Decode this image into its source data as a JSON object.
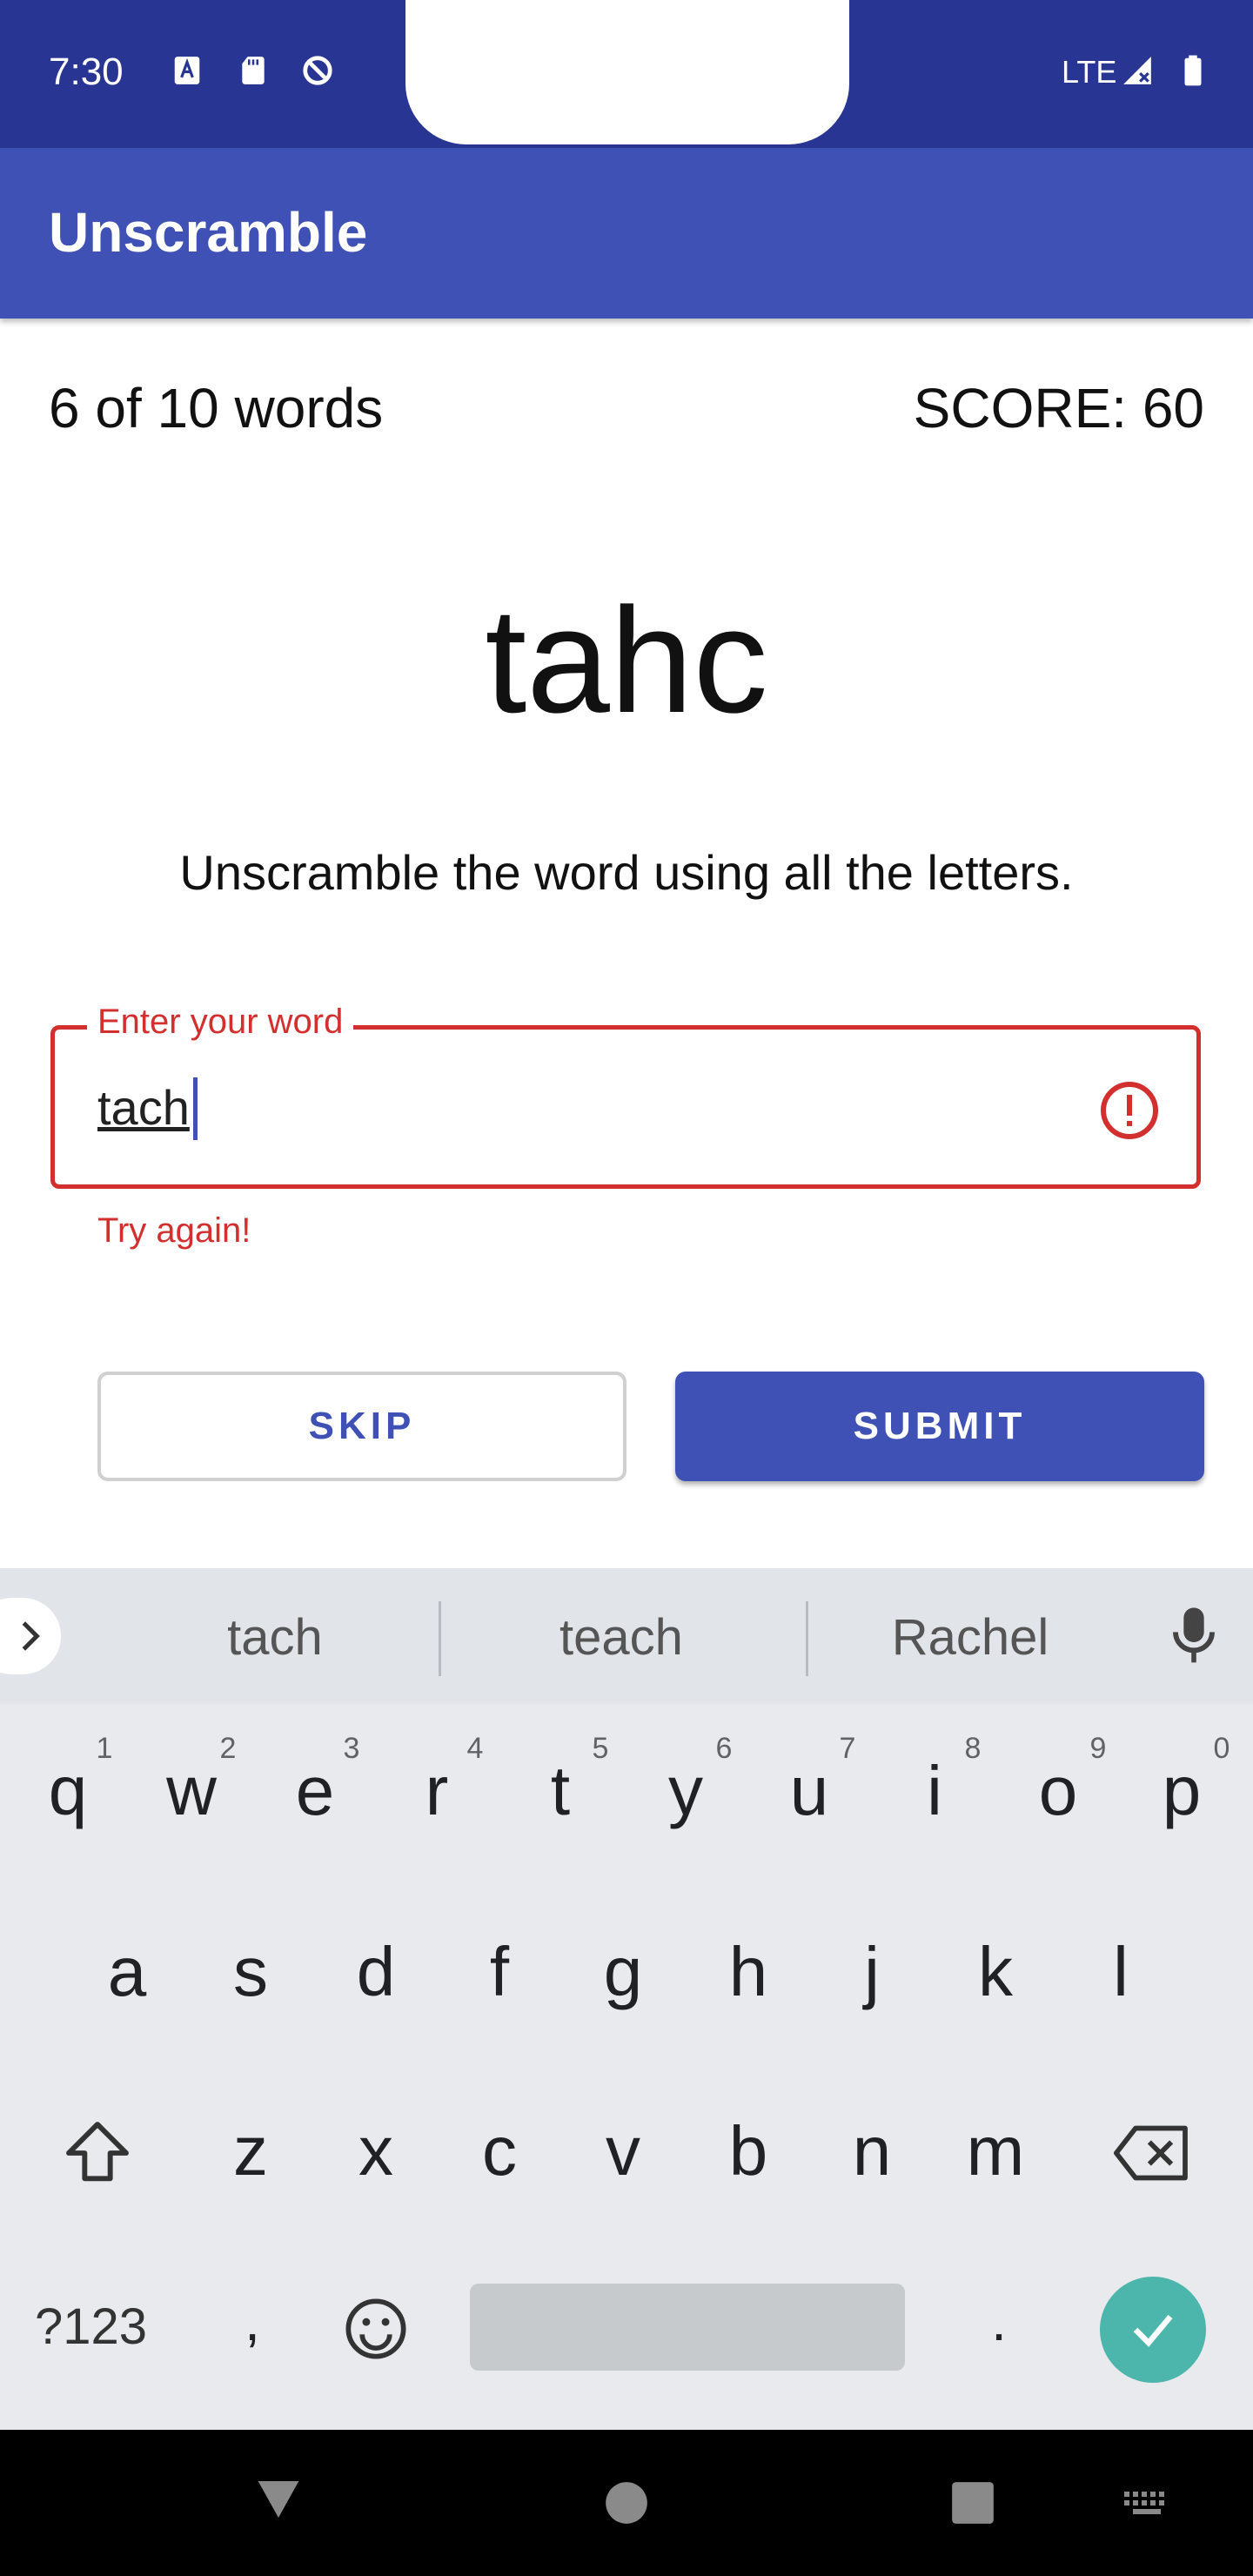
{
  "status_bar": {
    "time": "7:30",
    "network": "LTE"
  },
  "app_bar": {
    "title": "Unscramble"
  },
  "game": {
    "word_count": "6 of 10 words",
    "score": "SCORE: 60",
    "scrambled_word": "tahc",
    "instructions": "Unscramble the word using all the letters."
  },
  "input": {
    "label": "Enter your word",
    "value": "tach",
    "error": "Try again!"
  },
  "buttons": {
    "skip": "SKIP",
    "submit": "SUBMIT"
  },
  "keyboard": {
    "suggestions": [
      "tach",
      "teach",
      "Rachel"
    ],
    "row1": [
      "q",
      "w",
      "e",
      "r",
      "t",
      "y",
      "u",
      "i",
      "o",
      "p"
    ],
    "row1_hints": [
      "1",
      "2",
      "3",
      "4",
      "5",
      "6",
      "7",
      "8",
      "9",
      "0"
    ],
    "row2": [
      "a",
      "s",
      "d",
      "f",
      "g",
      "h",
      "j",
      "k",
      "l"
    ],
    "row3": [
      "z",
      "x",
      "c",
      "v",
      "b",
      "n",
      "m"
    ],
    "symbols_label": "?123",
    "comma": ",",
    "period": "."
  },
  "colors": {
    "primary": "#3f51b5",
    "primary_dark": "#283593",
    "error": "#d32f2f",
    "enter_key": "#4db6ac"
  }
}
